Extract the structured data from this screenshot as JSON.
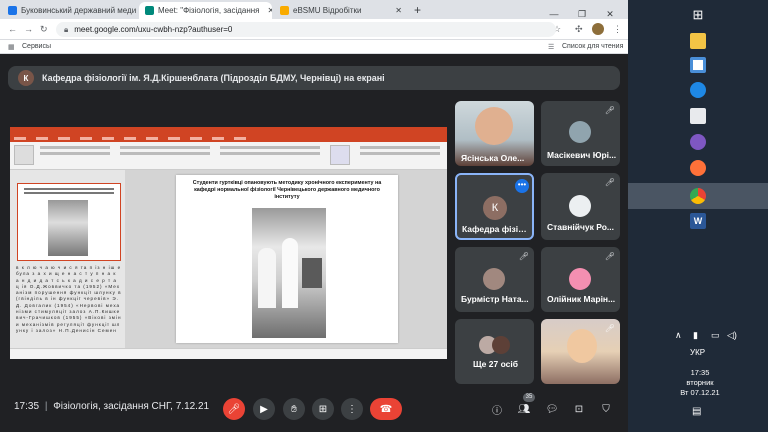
{
  "browser": {
    "tabs": [
      {
        "title": "Буковинський державний меди",
        "favicon_color": "#1a73e8"
      },
      {
        "title": "Meet: \"Фізіологія, засідання",
        "favicon_color": "#00897b"
      },
      {
        "title": "eBSMU Відробітки",
        "favicon_color": "#f9ab00"
      }
    ],
    "url": "meet.google.com/uxu-cwbh-nzp?authuser=0",
    "bookmarks": {
      "apps_label": "Сервисы",
      "reading_list": "Список для чтения"
    }
  },
  "meet": {
    "presenter_banner": "Кафедра фізіології ім. Я.Д.Кіршенблата (Підрозділ БДМУ, Чернівці) на екрані",
    "presenter_initial": "К",
    "slide": {
      "title": "Студенти гуртківці опановують методику хронічного експерименту на кафедрі нормальної фізіології Чернівецького державного медичного інституту",
      "notes": "в к л ю ч а ю ч и с я та п із н іш е була з а х и щ е н а с т у п н а к а н д и д а т с ь к а д и с е р т а ц ія О.Д.Жоввичко та (1952) «Механізм порушення функції шлунку в (гвінділь в ін функції черевів» Э.Д. Довгалик (1954) «Нервові механізми стимуляції залоз А.П.Кишкевич-Грачишков (1955) «Вікові зміни механізмів регуляції функції шлунку і залоз» Н.П.Денисін Семен"
    },
    "participants": [
      {
        "name": "Ясінська Оле...",
        "muted": false,
        "kind": "video"
      },
      {
        "name": "Масікевич Юрі...",
        "muted": true,
        "kind": "photo"
      },
      {
        "name": "Кафедра фізіо...",
        "muted": false,
        "kind": "initial",
        "initial": "К",
        "avatar_color": "#8d6e63"
      },
      {
        "name": "Ставнійчук Ро...",
        "muted": true,
        "kind": "photo"
      },
      {
        "name": "Бурмістр Ната...",
        "muted": true,
        "kind": "photo"
      },
      {
        "name": "Олійник Марін...",
        "muted": true,
        "kind": "photo"
      },
      {
        "name": "Ще 27 осіб",
        "muted": false,
        "kind": "more"
      },
      {
        "name": "",
        "muted": true,
        "kind": "video"
      }
    ],
    "bottom": {
      "time": "17:35",
      "separator": "|",
      "meeting_name": "Фізіологія, засідання СНГ, 7.12.21",
      "participants_count": "35"
    },
    "colors": {
      "accent": "#8ab4f8",
      "danger": "#ea4335"
    }
  },
  "taskbar": {
    "language": "УКР",
    "clock_time": "17:35",
    "clock_day": "вторник",
    "clock_date": "Вт 07.12.21"
  }
}
